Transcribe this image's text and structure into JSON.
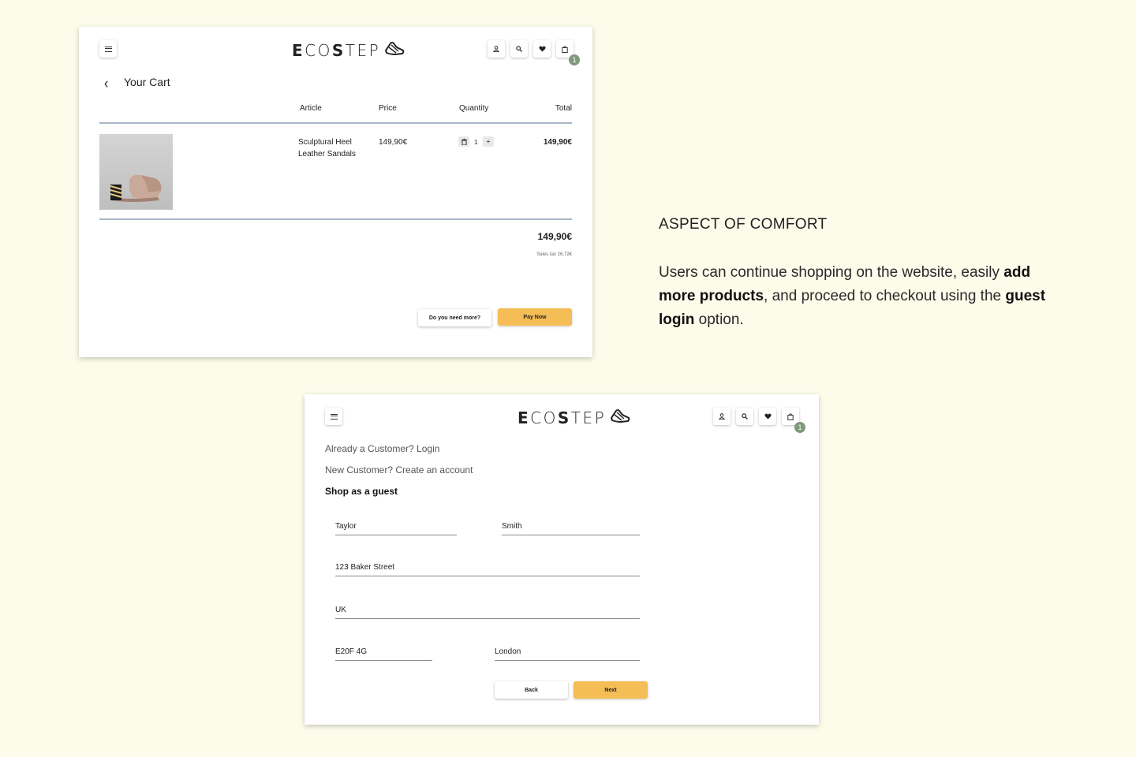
{
  "brand": {
    "logo_text_regular_a": "E",
    "logo_text_light": "CO",
    "logo_text_bold": "S",
    "logo_text_tail": "TEP",
    "accent_color": "#f4bd55",
    "badge_color": "#7e9a78",
    "background": "#fdfbea"
  },
  "header": {
    "icons": [
      "menu-icon",
      "user-icon",
      "search-icon",
      "heart-icon",
      "bag-icon"
    ],
    "cart_count": "1"
  },
  "cart": {
    "title": "Your Cart",
    "columns": {
      "article": "Article",
      "price": "Price",
      "quantity": "Quantity",
      "total": "Total"
    },
    "items": [
      {
        "name_line1": "Sculptural Heel",
        "name_line2": "Leather Sandals",
        "price": "149,90€",
        "quantity": "1",
        "total": "149,90€"
      }
    ],
    "grand_total": "149,90€",
    "sales_tax": "Sales tax 26,72€",
    "more_button": "Do you need more?",
    "pay_button": "Pay Now"
  },
  "guest": {
    "login_link": "Already a Customer? Login",
    "create_link": "New Customer? Create an account",
    "guest_title": "Shop as a guest",
    "fields": {
      "first_name": "Taylor",
      "last_name": "Smith",
      "street": "123 Baker Street",
      "country": "UK",
      "postcode": "E20F 4G",
      "city": "London"
    },
    "back_button": "Back",
    "next_button": "Next"
  },
  "description": {
    "heading": "ASPECT OF COMFORT",
    "p1": "Users can continue shopping on the website, easily ",
    "b1": "add more products",
    "p2": ", and proceed to checkout using the ",
    "b2": "guest login",
    "p3": " option."
  }
}
